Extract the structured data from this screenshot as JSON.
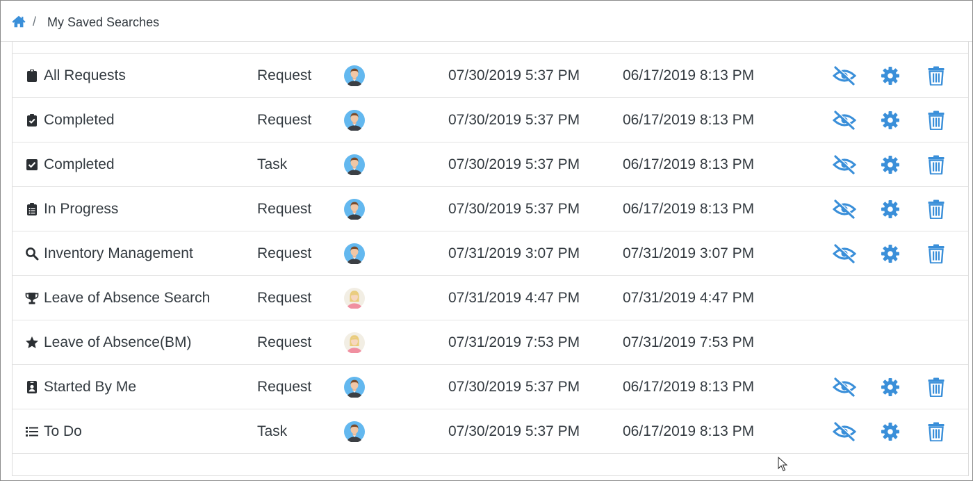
{
  "breadcrumb": {
    "home_icon": "home-icon",
    "separator": "/",
    "current": "My Saved Searches"
  },
  "colors": {
    "accent": "#3a8fd9",
    "text": "#333a40"
  },
  "rows": [
    {
      "icon": "clipboard-icon",
      "name": "All Requests",
      "type": "Request",
      "avatar": "male-avatar",
      "modified": "07/30/2019 5:37 PM",
      "created": "06/17/2019 8:13 PM",
      "actions": true
    },
    {
      "icon": "clipboard-check-icon",
      "name": "Completed",
      "type": "Request",
      "avatar": "male-avatar",
      "modified": "07/30/2019 5:37 PM",
      "created": "06/17/2019 8:13 PM",
      "actions": true
    },
    {
      "icon": "check-square-icon",
      "name": "Completed",
      "type": "Task",
      "avatar": "male-avatar",
      "modified": "07/30/2019 5:37 PM",
      "created": "06/17/2019 8:13 PM",
      "actions": true
    },
    {
      "icon": "clipboard-list-icon",
      "name": "In Progress",
      "type": "Request",
      "avatar": "male-avatar",
      "modified": "07/30/2019 5:37 PM",
      "created": "06/17/2019 8:13 PM",
      "actions": true
    },
    {
      "icon": "search-icon",
      "name": "Inventory Management",
      "type": "Request",
      "avatar": "male-avatar",
      "modified": "07/31/2019 3:07 PM",
      "created": "07/31/2019 3:07 PM",
      "actions": true
    },
    {
      "icon": "trophy-icon",
      "name": "Leave of Absence Search",
      "type": "Request",
      "avatar": "female-avatar",
      "modified": "07/31/2019 4:47 PM",
      "created": "07/31/2019 4:47 PM",
      "actions": false
    },
    {
      "icon": "star-icon",
      "name": "Leave of Absence(BM)",
      "type": "Request",
      "avatar": "female-avatar",
      "modified": "07/31/2019 7:53 PM",
      "created": "07/31/2019 7:53 PM",
      "actions": false
    },
    {
      "icon": "id-badge-icon",
      "name": "Started By Me",
      "type": "Request",
      "avatar": "male-avatar",
      "modified": "07/30/2019 5:37 PM",
      "created": "06/17/2019 8:13 PM",
      "actions": true
    },
    {
      "icon": "list-icon",
      "name": "To Do",
      "type": "Task",
      "avatar": "male-avatar",
      "modified": "07/30/2019 5:37 PM",
      "created": "06/17/2019 8:13 PM",
      "actions": true
    }
  ]
}
